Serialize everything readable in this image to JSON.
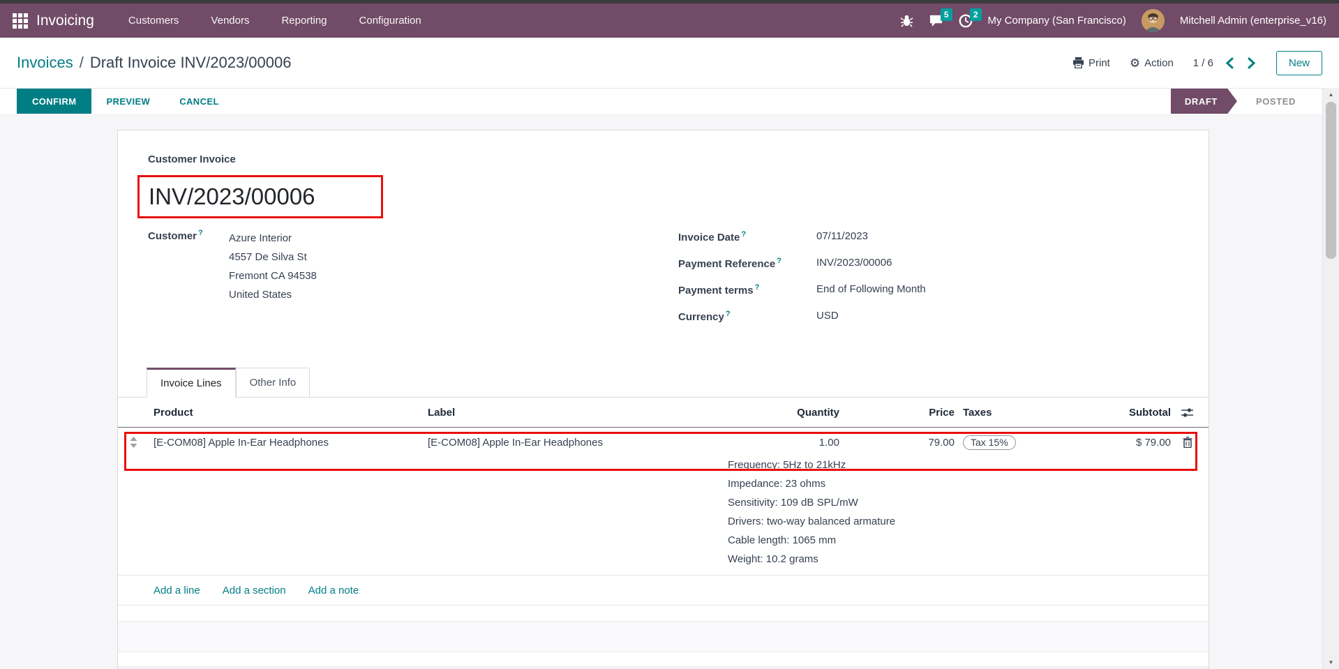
{
  "help_marker": "?",
  "nav": {
    "app_name": "Invoicing",
    "menus": [
      "Customers",
      "Vendors",
      "Reporting",
      "Configuration"
    ],
    "messages_badge": "5",
    "activities_badge": "2",
    "company": "My Company (San Francisco)",
    "user": "Mitchell Admin (enterprise_v16)"
  },
  "breadcrumb": {
    "parent": "Invoices",
    "separator": "/",
    "current": "Draft Invoice INV/2023/00006"
  },
  "control_panel": {
    "print": "Print",
    "action": "Action",
    "pager": "1 / 6",
    "new": "New"
  },
  "statusbar": {
    "confirm": "CONFIRM",
    "preview": "PREVIEW",
    "cancel": "CANCEL",
    "state_active": "DRAFT",
    "state_next": "POSTED"
  },
  "invoice": {
    "type_label": "Customer Invoice",
    "number": "INV/2023/00006",
    "customer": {
      "label": "Customer",
      "name": "Azure Interior",
      "address": [
        "4557 De Silva St",
        "Fremont CA 94538",
        "United States"
      ]
    },
    "details": [
      {
        "label": "Invoice Date",
        "value": "07/11/2023"
      },
      {
        "label": "Payment Reference",
        "value": "INV/2023/00006"
      },
      {
        "label": "Payment terms",
        "value": "End of Following Month"
      },
      {
        "label": "Currency",
        "value": "USD"
      }
    ],
    "tabs": [
      {
        "label": "Invoice Lines"
      },
      {
        "label": "Other Info"
      }
    ],
    "lines_table": {
      "headers": {
        "product": "Product",
        "label": "Label",
        "quantity": "Quantity",
        "price": "Price",
        "taxes": "Taxes",
        "subtotal": "Subtotal"
      },
      "rows": [
        {
          "product": "[E-COM08] Apple In-Ear Headphones",
          "label": "[E-COM08] Apple In-Ear Headphones",
          "description": [
            "Frequency: 5Hz to 21kHz",
            "Impedance: 23 ohms",
            "Sensitivity: 109 dB SPL/mW",
            "Drivers: two-way balanced armature",
            "Cable length: 1065 mm",
            "Weight: 10.2 grams"
          ],
          "quantity": "1.00",
          "price": "79.00",
          "taxes": "Tax 15%",
          "subtotal": "$ 79.00"
        }
      ],
      "footer_links": [
        "Add a line",
        "Add a section",
        "Add a note"
      ]
    }
  },
  "colors": {
    "brand_purple": "#714B67",
    "accent_teal": "#017e84",
    "badge_teal": "#00a09d",
    "highlight_red": "#e8100c",
    "draft_ribbon": "#714B67"
  }
}
